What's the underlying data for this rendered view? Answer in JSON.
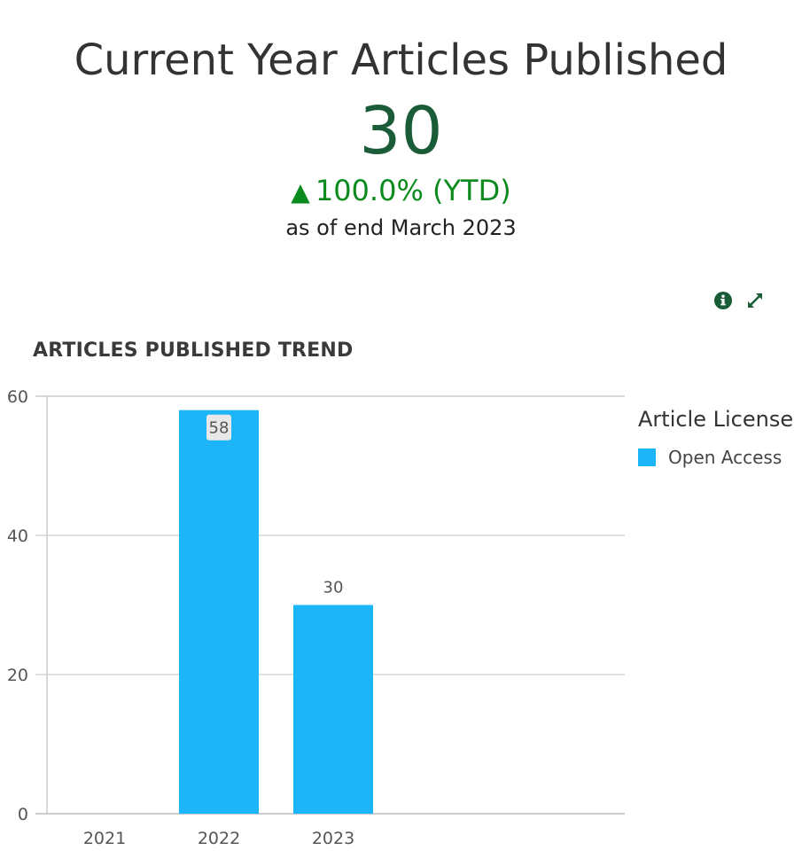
{
  "kpi": {
    "title": "Current Year Articles Published",
    "value": "30",
    "change_arrow": "▲",
    "change_text": "100.0% (YTD)",
    "as_of": "as of end March 2023"
  },
  "tools": {
    "info_icon": "info-circle-icon",
    "expand_icon": "expand-arrows-icon",
    "icon_color": "#1a5c38"
  },
  "colors": {
    "value": "#1a5c38",
    "change_positive": "#0b8a1e",
    "series": "#1cb5f8"
  },
  "legend": {
    "title": "Article License",
    "items": [
      {
        "label": "Open Access",
        "color": "#1cb5f8"
      }
    ]
  },
  "chart_data": {
    "type": "bar",
    "title": "ARTICLES PUBLISHED TREND",
    "categories": [
      "2021",
      "2022",
      "2023"
    ],
    "series": [
      {
        "name": "Open Access",
        "values": [
          0,
          58,
          30
        ],
        "color": "#1cb5f8"
      }
    ],
    "data_labels": [
      "",
      "58",
      "30"
    ],
    "highlighted_label_index": 1,
    "ylim": [
      0,
      60
    ],
    "yticks": [
      0,
      20,
      40,
      60
    ],
    "grid": true,
    "legend_position": "right"
  }
}
